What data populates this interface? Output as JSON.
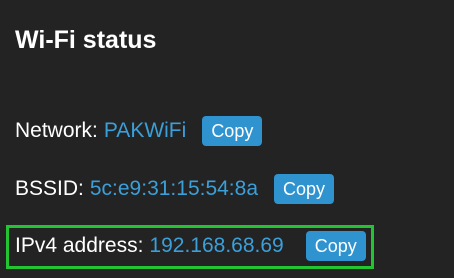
{
  "panel": {
    "title": "Wi-Fi status"
  },
  "network": {
    "label": "Network:",
    "value": "PAKWiFi",
    "copy_label": "Copy"
  },
  "bssid": {
    "label": "BSSID:",
    "value": "5c:e9:31:15:54:8a",
    "copy_label": "Copy"
  },
  "ipv4": {
    "label": "IPv4 address:",
    "value": "192.168.68.69",
    "copy_label": "Copy"
  },
  "colors": {
    "background": "#232323",
    "text": "#ffffff",
    "value": "#3b9fd9",
    "button": "#2f93cf",
    "highlight_border": "#23c432"
  }
}
